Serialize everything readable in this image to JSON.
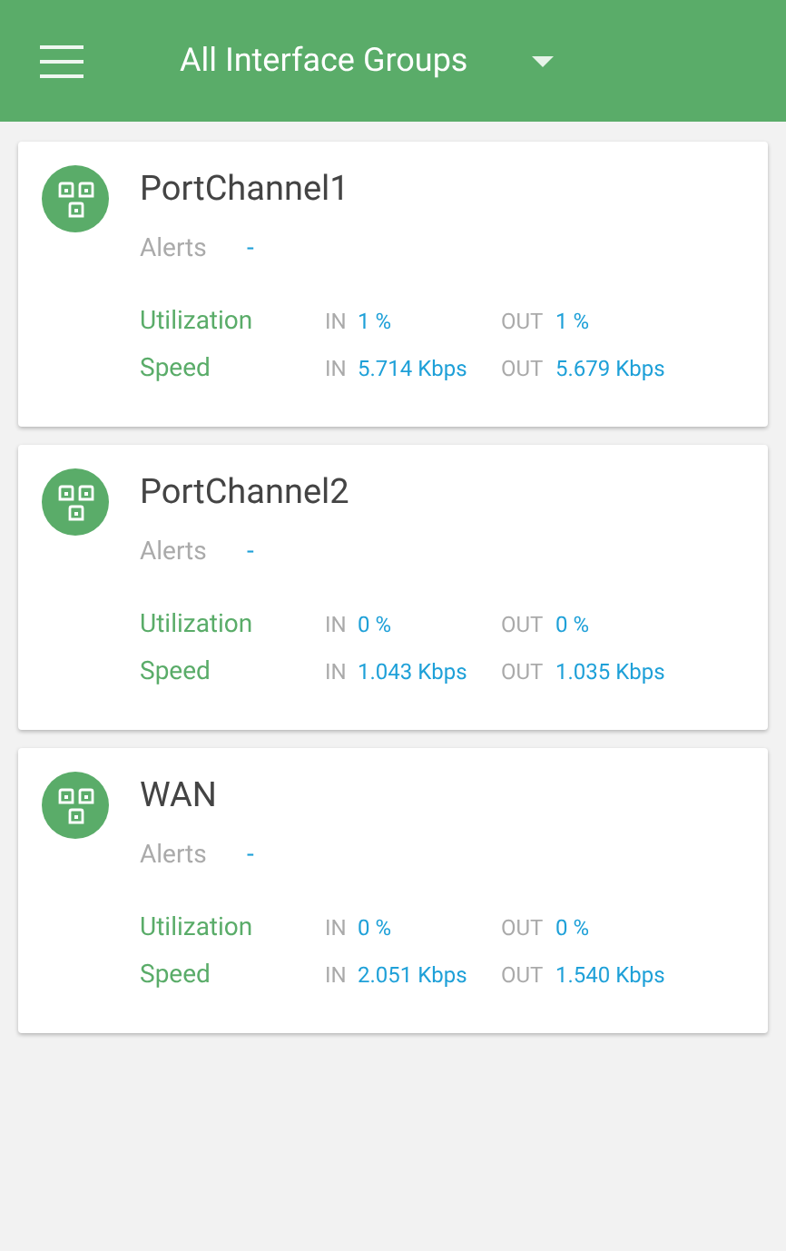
{
  "header": {
    "title": "All Interface Groups"
  },
  "groups": [
    {
      "name": "PortChannel1",
      "alerts_label": "Alerts",
      "alerts": "-",
      "rows": [
        {
          "label": "Utilization",
          "in_label": "IN",
          "in": "1 %",
          "out_label": "OUT",
          "out": "1 %"
        },
        {
          "label": "Speed",
          "in_label": "IN",
          "in": "5.714 Kbps",
          "out_label": "OUT",
          "out": "5.679 Kbps"
        }
      ]
    },
    {
      "name": "PortChannel2",
      "alerts_label": "Alerts",
      "alerts": "-",
      "rows": [
        {
          "label": "Utilization",
          "in_label": "IN",
          "in": "0 %",
          "out_label": "OUT",
          "out": "0 %"
        },
        {
          "label": "Speed",
          "in_label": "IN",
          "in": "1.043 Kbps",
          "out_label": "OUT",
          "out": "1.035 Kbps"
        }
      ]
    },
    {
      "name": "WAN",
      "alerts_label": "Alerts",
      "alerts": "-",
      "rows": [
        {
          "label": "Utilization",
          "in_label": "IN",
          "in": "0 %",
          "out_label": "OUT",
          "out": "0 %"
        },
        {
          "label": "Speed",
          "in_label": "IN",
          "in": "2.051 Kbps",
          "out_label": "OUT",
          "out": "1.540 Kbps"
        }
      ]
    }
  ]
}
